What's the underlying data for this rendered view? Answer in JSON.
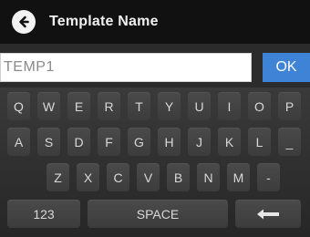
{
  "header": {
    "title": "Template Name",
    "back_icon": "back-arrow-icon"
  },
  "input": {
    "value": "TEMP1"
  },
  "ok_label": "OK",
  "colors": {
    "accent": "#3f83d6",
    "titlebar": "#111111",
    "key_text": "#d8d8d8"
  },
  "keyboard": {
    "row1": [
      "Q",
      "W",
      "E",
      "R",
      "T",
      "Y",
      "U",
      "I",
      "O",
      "P"
    ],
    "row2": [
      "A",
      "S",
      "D",
      "F",
      "G",
      "H",
      "J",
      "K",
      "L",
      "_"
    ],
    "row3": [
      "Z",
      "X",
      "C",
      "V",
      "B",
      "N",
      "M",
      "-"
    ],
    "numbers_label": "123",
    "space_label": "SPACE",
    "backspace_icon": "backspace-arrow-icon"
  }
}
